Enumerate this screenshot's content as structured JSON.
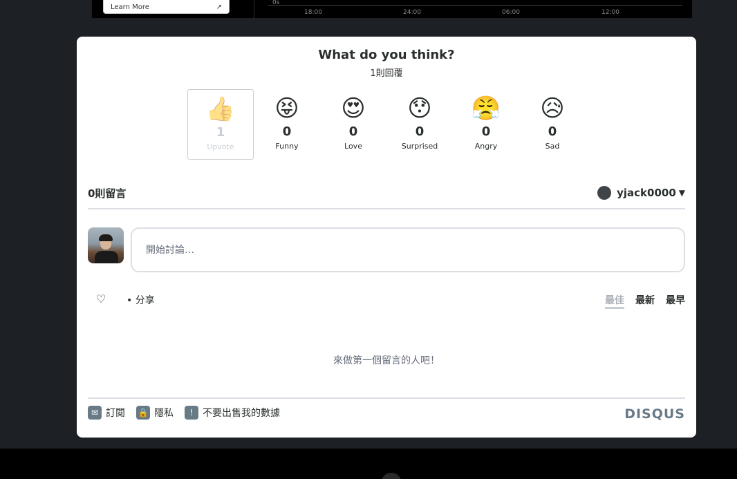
{
  "top_strip": {
    "learn_more": "Learn More",
    "axis_labels": [
      "0s",
      "18:00",
      "24:00",
      "06:00",
      "12:00"
    ]
  },
  "reactions_header": {
    "title": "What do you think?",
    "responses": "1則回覆"
  },
  "reactions": [
    {
      "emoji": "👍",
      "count": "1",
      "label": "Upvote",
      "selected": true
    },
    {
      "emoji": "😝",
      "count": "0",
      "label": "Funny",
      "selected": false
    },
    {
      "emoji": "😍",
      "count": "0",
      "label": "Love",
      "selected": false
    },
    {
      "emoji": "😯",
      "count": "0",
      "label": "Surprised",
      "selected": false
    },
    {
      "emoji": "😤",
      "count": "0",
      "label": "Angry",
      "selected": false
    },
    {
      "emoji": "😥",
      "count": "0",
      "label": "Sad",
      "selected": false
    }
  ],
  "comments": {
    "count_label": "0則留言",
    "username": "yjack0000",
    "placeholder": "開始討論…",
    "share": "分享",
    "sort": [
      "最佳",
      "最新",
      "最早"
    ],
    "empty": "來做第一個留言的人吧！"
  },
  "footer": {
    "subscribe": "訂閱",
    "privacy": "隱私",
    "do_not_sell": "不要出售我的數據",
    "brand": "DISQUS"
  }
}
